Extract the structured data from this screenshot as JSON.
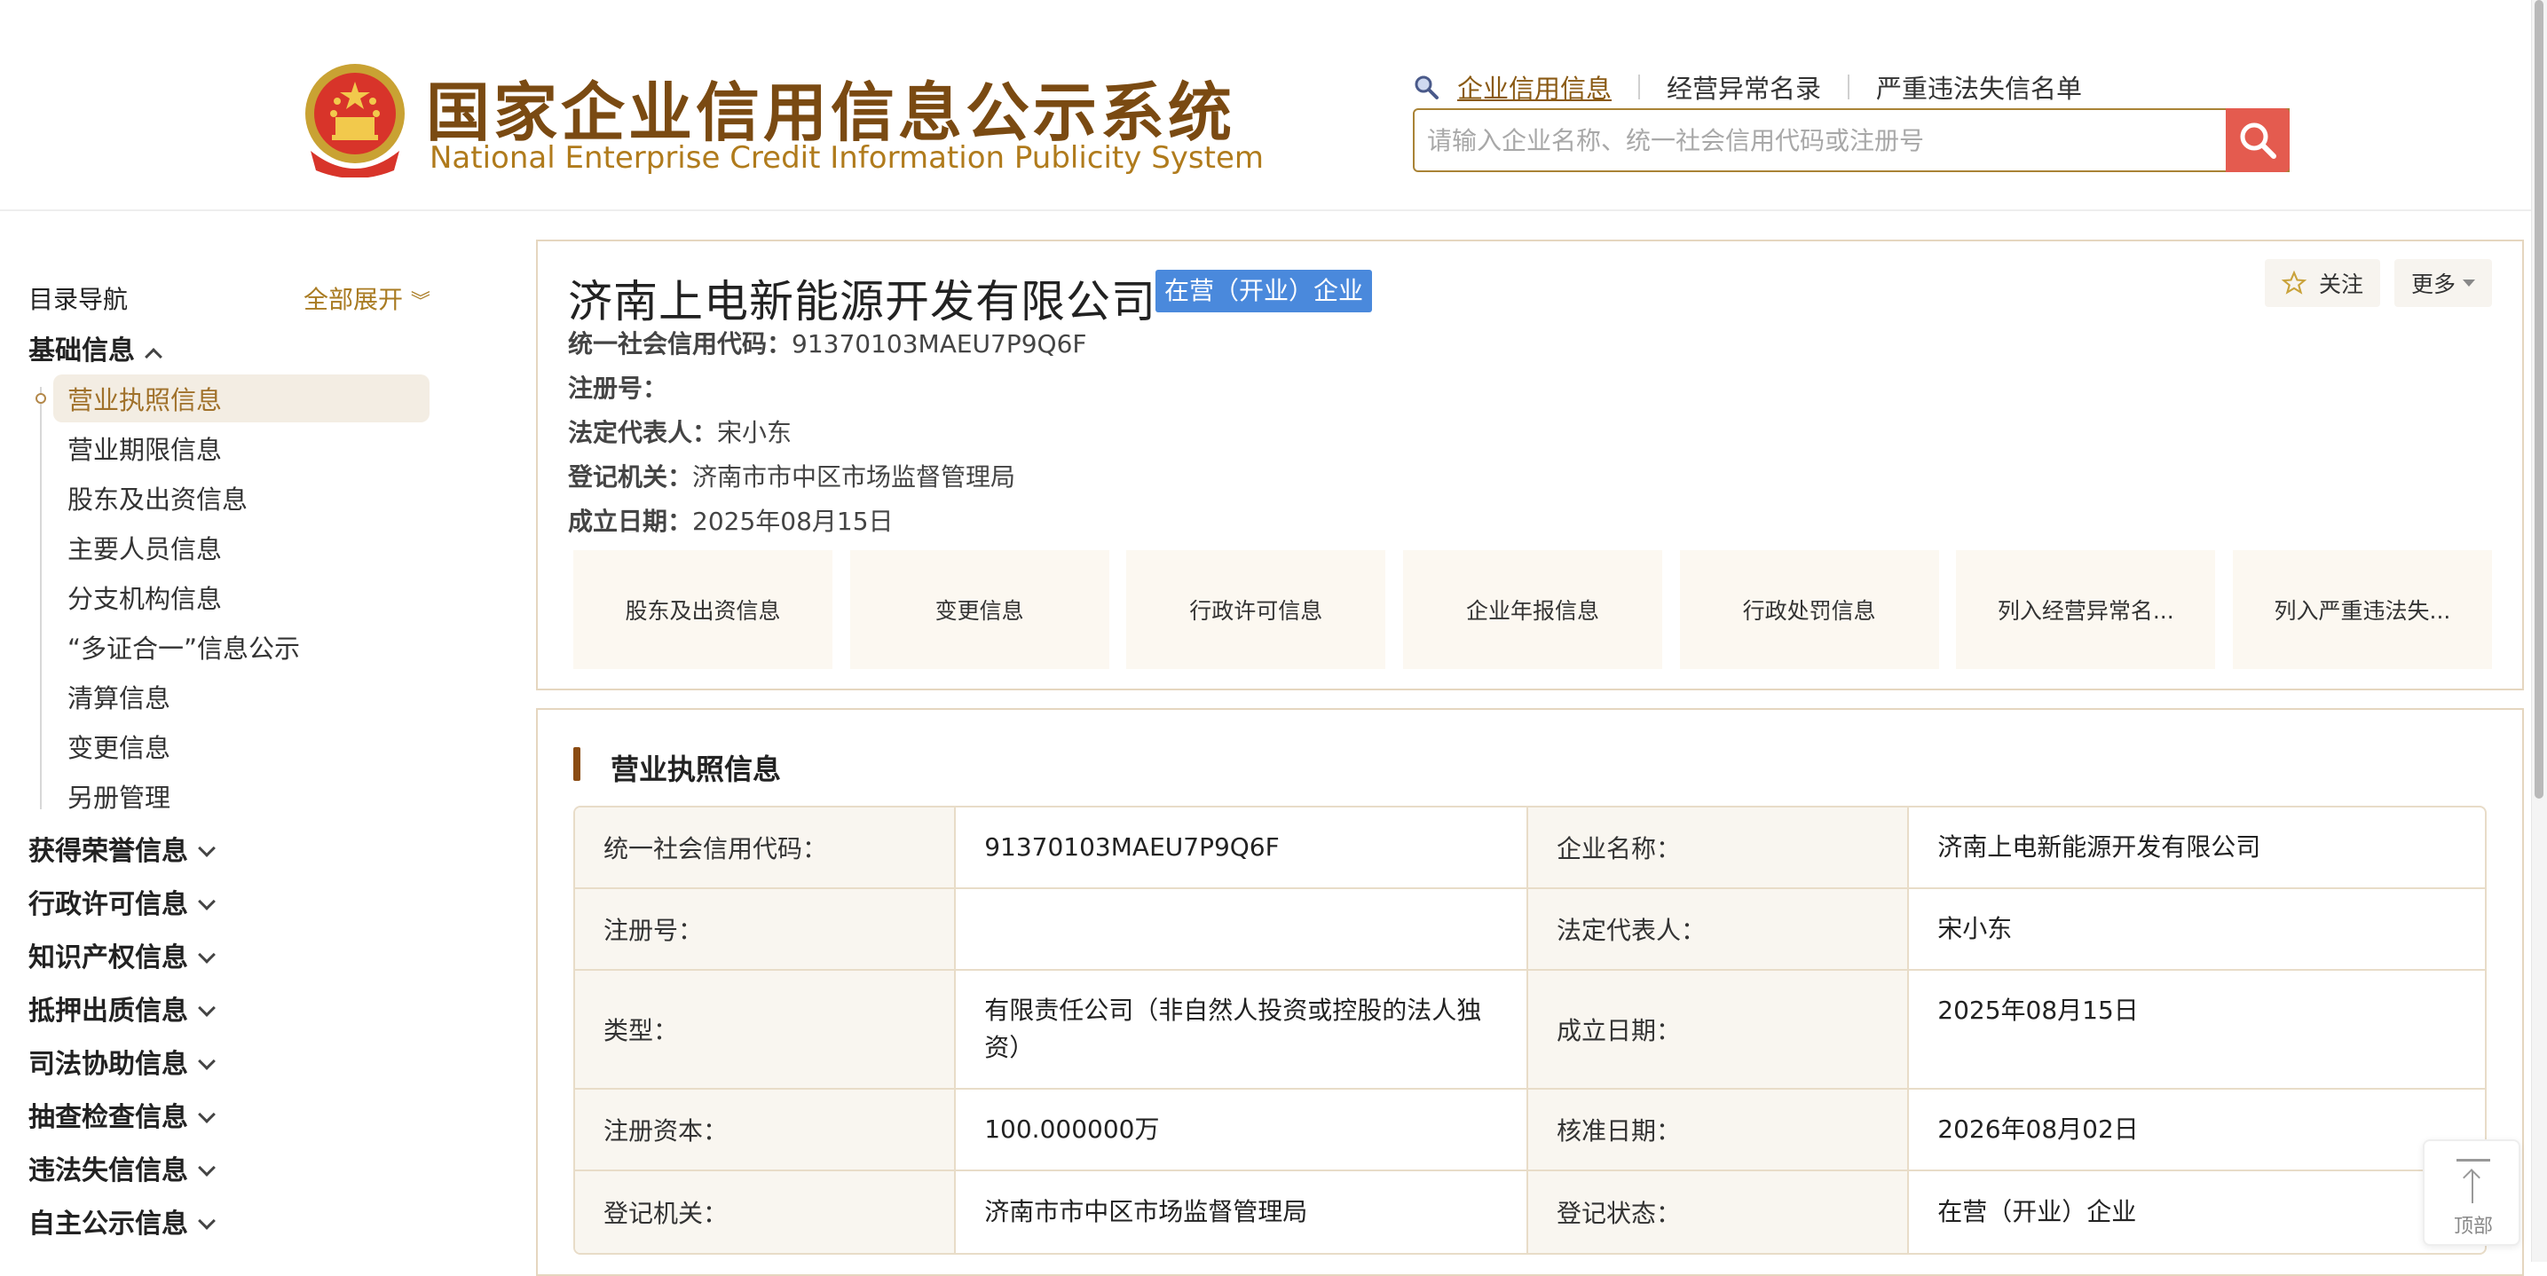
{
  "header": {
    "logo_cn": "国家企业信用信息公示系统",
    "logo_en": "National Enterprise Credit Information Publicity System",
    "nav": [
      "企业信用信息",
      "经营异常名录",
      "严重违法失信名单"
    ],
    "search_placeholder": "请输入企业名称、统一社会信用代码或注册号"
  },
  "sidebar": {
    "title": "目录导航",
    "expand_all": "全部展开",
    "basic": {
      "label": "基础信息",
      "items": [
        "营业执照信息",
        "营业期限信息",
        "股东及出资信息",
        "主要人员信息",
        "分支机构信息",
        "“多证合一”信息公示",
        "清算信息",
        "变更信息",
        "另册管理"
      ]
    },
    "sections": [
      "获得荣誉信息",
      "行政许可信息",
      "知识产权信息",
      "抵押出质信息",
      "司法协助信息",
      "抽查检查信息",
      "违法失信信息",
      "自主公示信息"
    ]
  },
  "company": {
    "name": "济南上电新能源开发有限公司",
    "status": "在营（开业）企业",
    "follow": "关注",
    "more": "更多",
    "credit_code_label": "统一社会信用代码：",
    "credit_code": "91370103MAEU7P9Q6F",
    "reg_no_label": "注册号：",
    "legal_rep_label": "法定代表人：",
    "legal_rep": "宋小东",
    "authority_label": "登记机关：",
    "authority": "济南市市中区市场监督管理局",
    "founded_label": "成立日期：",
    "founded": "2025年08月15日"
  },
  "quick_links": [
    "股东及出资信息",
    "变更信息",
    "行政许可信息",
    "企业年报信息",
    "行政处罚信息",
    "列入经营异常名...",
    "列入严重违法失..."
  ],
  "license": {
    "title": "营业执照信息",
    "rows": [
      {
        "l1": "统一社会信用代码：",
        "v1": "91370103MAEU7P9Q6F",
        "l2": "企业名称：",
        "v2": "济南上电新能源开发有限公司"
      },
      {
        "l1": "注册号：",
        "v1": "",
        "l2": "法定代表人：",
        "v2": "宋小东"
      },
      {
        "l1": "类型：",
        "v1": "有限责任公司（非自然人投资或控股的法人独资）",
        "l2": "成立日期：",
        "v2": "2025年08月15日"
      },
      {
        "l1": "注册资本：",
        "v1": "100.000000万",
        "l2": "核准日期：",
        "v2": "2026年08月02日"
      },
      {
        "l1": "登记机关：",
        "v1": "济南市市中区市场监督管理局",
        "l2": "登记状态：",
        "v2": "在营（开业）企业"
      }
    ]
  },
  "back_to_top": "顶部",
  "colors": {
    "brand_brown": "#7a4a12",
    "gold": "#b07b1c",
    "search_red": "#e45b4f",
    "status_blue": "#4a89dc"
  }
}
